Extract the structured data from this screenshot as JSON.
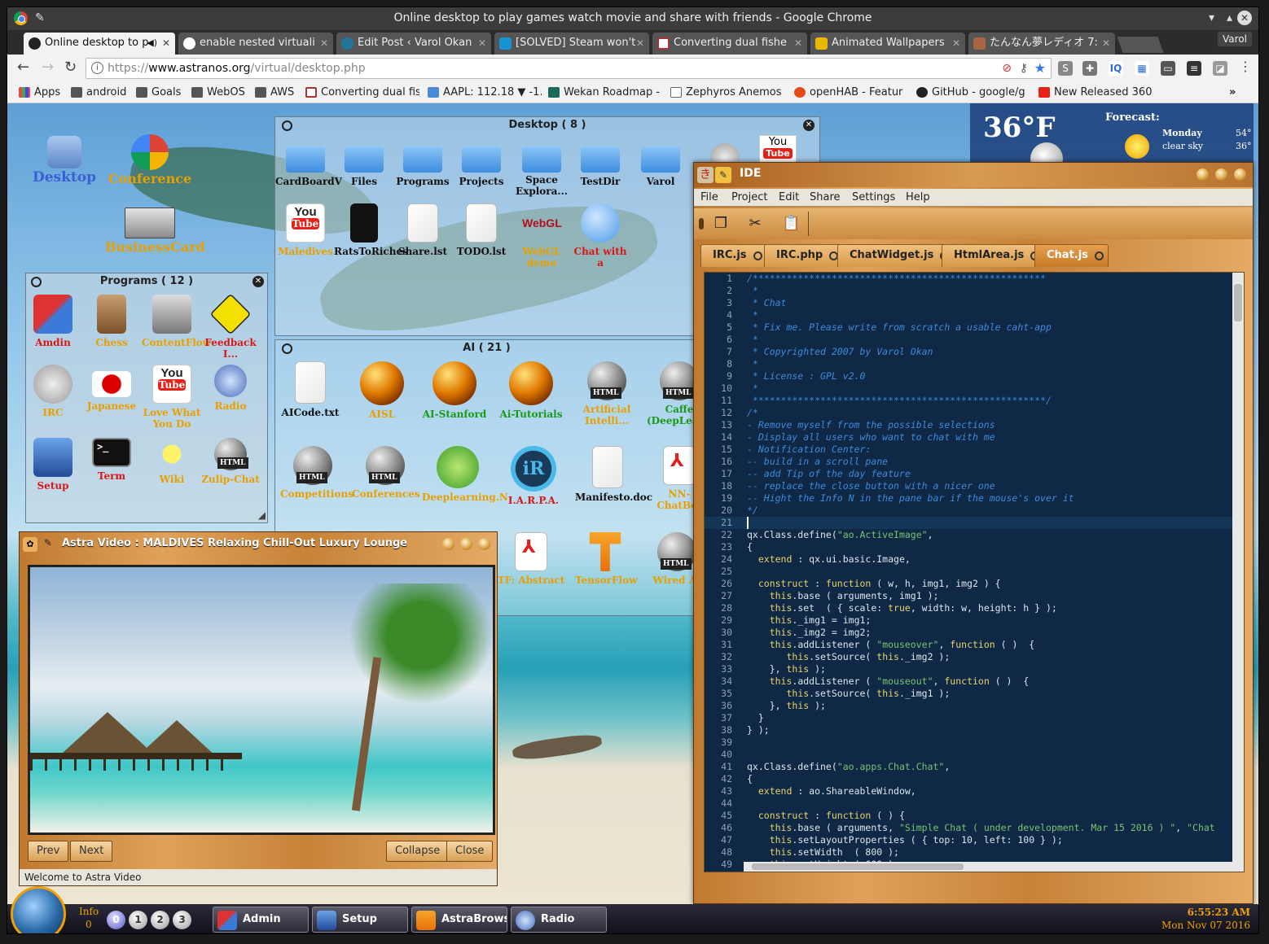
{
  "window": {
    "title": "Online desktop to play games watch movie and share with friends - Google Chrome"
  },
  "tabs": [
    {
      "label": "Online desktop to p",
      "active": true
    },
    {
      "label": "enable nested virtuali",
      "active": false
    },
    {
      "label": "Edit Post ‹ Varol Okan",
      "active": false
    },
    {
      "label": "[SOLVED] Steam won't",
      "active": false
    },
    {
      "label": "Converting dual fishe",
      "active": false
    },
    {
      "label": "Animated Wallpapers",
      "active": false
    },
    {
      "label": "たんなん夢レディオ 7:",
      "active": false
    }
  ],
  "profile": "Varol",
  "address": {
    "scheme": "https://",
    "host": "www.astranos.org",
    "path": "/virtual/desktop.php"
  },
  "bookmarks": [
    "Apps",
    "android",
    "Goals",
    "WebOS",
    "AWS",
    "Converting dual fis",
    "AAPL: 112.18 ▼ -1.",
    "Wekan Roadmap -",
    "Zephyros Anemos",
    "openHAB - Feature",
    "GitHub - google/gr",
    "New Released 360"
  ],
  "desktop": {
    "icons": [
      {
        "label": "Desktop",
        "color": "#3a5fd6"
      },
      {
        "label": "Conference",
        "color": "#e8a000"
      },
      {
        "label": "BusinessCard",
        "color": "#e8a000"
      }
    ]
  },
  "desktop_window": {
    "title": "Desktop ( 8 )",
    "icons": [
      "CardBoardV",
      "Files",
      "Programs",
      "Projects",
      "Space Explora...",
      "TestDir",
      "Varol",
      "Maledives",
      "RatsToRiches",
      "Share.lst",
      "TODO.lst",
      "WebGL demo",
      "Chat with a"
    ]
  },
  "programs_window": {
    "title": "Programs ( 12 )",
    "icons": [
      "Amdin",
      "Chess",
      "ContentFlow",
      "Feedback I...",
      "IRC",
      "Japanese",
      "Love What You Do",
      "Radio",
      "Setup",
      "Term",
      "Wiki",
      "Zulip-Chat"
    ]
  },
  "ai_window": {
    "title": "AI ( 21 )",
    "icons": [
      "AICode.txt",
      "AISL",
      "AI-Stanford",
      "Ai-Tutorials",
      "Artificial Intelli...",
      "Caffe (DeepLearning)",
      "Competitions",
      "Conferences",
      "Deeplearning.N",
      "I.A.R.P.A.",
      "Manifesto.doc",
      "NN-ChatBot",
      "TF: Abstract",
      "TensorFlow",
      "Wired AI"
    ]
  },
  "weather": {
    "temp": "36°F",
    "forecast_label": "Forecast:",
    "day": "Monday",
    "condition": "clear sky",
    "high": "54°",
    "low": "36°"
  },
  "ide": {
    "title": "IDE",
    "menu": [
      "File",
      "Project",
      "Edit",
      "Share",
      "Settings",
      "Help"
    ],
    "tabs": [
      "IRC.js",
      "IRC.php",
      "ChatWidget.js",
      "HtmlArea.js",
      "Chat.js"
    ],
    "active_tab": "Chat.js",
    "first_line": 1,
    "code": [
      "/****************************************************",
      " *",
      " * Chat",
      " *",
      " * Fix me. Please write from scratch a usable caht-app",
      " *",
      " * Copyrighted 2007 by Varol Okan",
      " *",
      " * License : GPL v2.0",
      " *",
      " ****************************************************/",
      "/*",
      "- Remove myself from the possible selections",
      "- Display all users who want to chat with me",
      "- Notification Center:",
      "-- build in a scroll pane",
      "-- add Tip of the day feature",
      "-- replace the close button with a nicer one",
      "-- Hight the Info N in the pane bar if the mouse's over it",
      "*/",
      "",
      "qx.Class.define(\"ao.ActiveImage\",",
      "{",
      "  extend : qx.ui.basic.Image,",
      "",
      "  construct : function ( w, h, img1, img2 ) {",
      "    this.base ( arguments, img1 );",
      "    this.set  ( { scale: true, width: w, height: h } );",
      "    this._img1 = img1;",
      "    this._img2 = img2;",
      "    this.addListener ( \"mouseover\", function ( )  {",
      "       this.setSource( this._img2 );",
      "    }, this );",
      "    this.addListener ( \"mouseout\", function ( )  {",
      "       this.setSource( this._img1 );",
      "    }, this );",
      "  }",
      "} );",
      "",
      "",
      "qx.Class.define(\"ao.apps.Chat.Chat\",",
      "{",
      "  extend : ao.ShareableWindow,",
      "",
      "  construct : function ( ) {",
      "    this.base ( arguments, \"Simple Chat ( under development. Mar 15 2016 ) \", \"Chat",
      "    this.setLayoutProperties ( { top: 10, left: 100 } );",
      "    this.setWidth  ( 800 );",
      "    this.setHeight ( 600 );"
    ]
  },
  "video": {
    "title": "Astra Video : MALDIVES Relaxing Chill-Out Luxury Lounge",
    "prev": "Prev",
    "next": "Next",
    "collapse": "Collapse",
    "close": "Close",
    "status": "Welcome to Astra Video"
  },
  "taskbar": {
    "info_label": "Info",
    "info_count": "0",
    "workspaces": [
      "0",
      "1",
      "2",
      "3"
    ],
    "buttons": [
      "Admin",
      "Setup",
      "AstraBrowser",
      "Radio"
    ],
    "time": "6:55:23 AM",
    "date": "Mon Nov 07 2016"
  }
}
